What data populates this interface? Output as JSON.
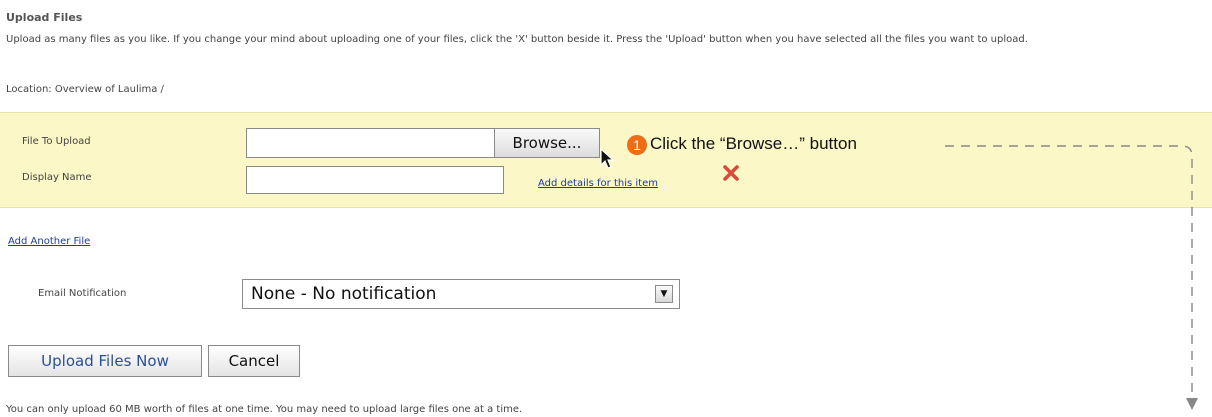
{
  "page": {
    "title": "Upload Files",
    "intro": "Upload as many files as you like. If you change your mind about uploading one of your files, click the 'X' button beside it. Press the 'Upload' button when you have selected all the files you want to upload.",
    "location": "Location: Overview of Laulima /"
  },
  "file_row": {
    "file_label": "File To Upload",
    "browse_label": "Browse...",
    "display_label": "Display Name",
    "add_details_link": "Add details for this item",
    "file_value": "",
    "display_value": ""
  },
  "callout": {
    "step_number": "1",
    "text": "Click the “Browse…” button",
    "badge_color": "#ef6c16"
  },
  "add_another_link": "Add Another File",
  "email": {
    "label": "Email Notification",
    "selected": "None - No notification"
  },
  "actions": {
    "upload_label": "Upload Files Now",
    "cancel_label": "Cancel"
  },
  "footnote": "You can only upload 60 MB worth of files at one time. You may need to upload large files one at a time.",
  "colors": {
    "panel_bg": "#fbf7c6",
    "link": "#1a3d9e",
    "remove_x": "#d84a3a"
  }
}
